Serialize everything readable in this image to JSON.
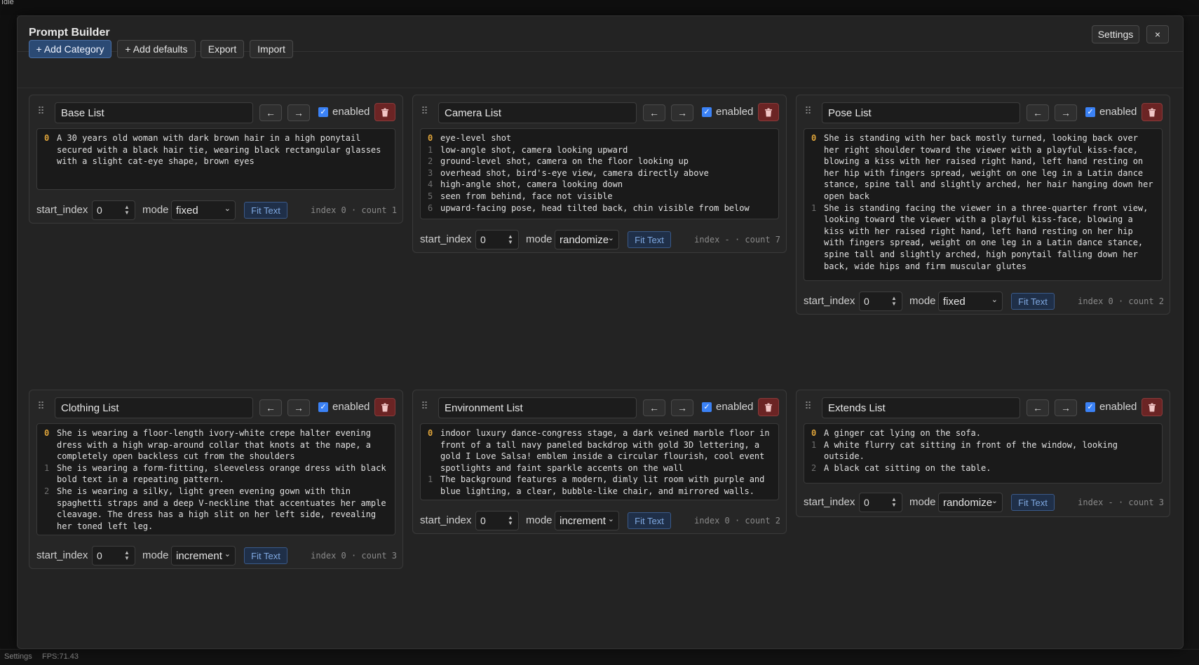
{
  "background": {
    "status": "Idle",
    "bottom_left": "Settings",
    "fps": "FPS:71.43"
  },
  "modal": {
    "title": "Prompt Builder",
    "settings_label": "Settings",
    "close_label": "×"
  },
  "toolbar": {
    "add_category": "+ Add Category",
    "add_defaults": "+ Add defaults",
    "export": "Export",
    "import": "Import"
  },
  "common": {
    "prev_arrow": "←",
    "next_arrow": "→",
    "enabled_label": "enabled",
    "start_index_label": "start_index",
    "mode_label": "mode",
    "fit_text_label": "Fit Text"
  },
  "cards": [
    {
      "name": "Base List",
      "enabled": true,
      "lines": [
        {
          "n": "0",
          "text": "A 30 years old woman with dark brown hair in a high ponytail secured with a black hair tie, wearing black rectangular glasses with a slight cat-eye shape, brown eyes"
        }
      ],
      "start_index": "0",
      "mode": "fixed",
      "status": "index 0 · count 1"
    },
    {
      "name": "Camera List",
      "enabled": true,
      "lines": [
        {
          "n": "0",
          "text": "eye-level shot"
        },
        {
          "n": "1",
          "text": "low-angle shot, camera looking upward"
        },
        {
          "n": "2",
          "text": "ground-level shot, camera on the floor looking up"
        },
        {
          "n": "3",
          "text": "overhead shot, bird's-eye view, camera directly above"
        },
        {
          "n": "4",
          "text": "high-angle shot, camera looking down"
        },
        {
          "n": "5",
          "text": "seen from behind, face not visible"
        },
        {
          "n": "6",
          "text": "upward-facing pose, head tilted back, chin visible from below"
        }
      ],
      "start_index": "0",
      "mode": "randomize",
      "status": "index - · count 7"
    },
    {
      "name": "Pose List",
      "enabled": true,
      "lines": [
        {
          "n": "0",
          "text": "She is standing with her back mostly turned, looking back over her right shoulder toward the viewer with a playful kiss-face, blowing a kiss with her raised right hand, left hand resting on her hip with fingers spread, weight on one leg in a Latin dance stance, spine tall and slightly arched, her hair hanging down her open back"
        },
        {
          "n": "1",
          "text": "She is standing facing the viewer in a three-quarter front view, looking toward the viewer with a playful kiss-face, blowing a kiss with her raised right hand, left hand resting on her hip with fingers spread, weight on one leg in a Latin dance stance, spine tall and slightly arched, high ponytail falling down her back, wide hips and firm muscular glutes"
        }
      ],
      "start_index": "0",
      "mode": "fixed",
      "status": "index 0 · count 2"
    },
    {
      "name": "Clothing List",
      "enabled": true,
      "lines": [
        {
          "n": "0",
          "text": "She is wearing a floor-length ivory-white crepe halter evening dress with a high wrap-around collar that knots at the nape, a completely open backless cut from the shoulders"
        },
        {
          "n": "1",
          "text": "She is wearing a form-fitting, sleeveless orange dress with black bold text in a repeating pattern."
        },
        {
          "n": "2",
          "text": "She is wearing a silky, light green evening gown with thin spaghetti straps and a deep V-neckline that accentuates her ample cleavage. The dress has a high slit on her left side, revealing her toned left leg."
        }
      ],
      "start_index": "0",
      "mode": "increment",
      "status": "index 0 · count 3"
    },
    {
      "name": "Environment List",
      "enabled": true,
      "lines": [
        {
          "n": "0",
          "text": "indoor luxury dance-congress stage, a dark veined marble floor in front of a tall navy paneled backdrop with gold 3D lettering, a gold I Love Salsa! emblem inside a circular flourish, cool event spotlights and faint sparkle accents on the wall"
        },
        {
          "n": "1",
          "text": "The background features a modern, dimly lit room with purple and blue lighting, a clear, bubble-like chair, and mirrored walls."
        }
      ],
      "start_index": "0",
      "mode": "increment",
      "status": "index 0 · count 2"
    },
    {
      "name": "Extends List",
      "enabled": true,
      "lines": [
        {
          "n": "0",
          "text": "A ginger cat lying on the sofa."
        },
        {
          "n": "1",
          "text": "A white flurry cat sitting in front of the window, looking outside."
        },
        {
          "n": "2",
          "text": "A black cat sitting on the table."
        }
      ],
      "start_index": "0",
      "mode": "randomize",
      "status": "index - · count 3"
    }
  ]
}
